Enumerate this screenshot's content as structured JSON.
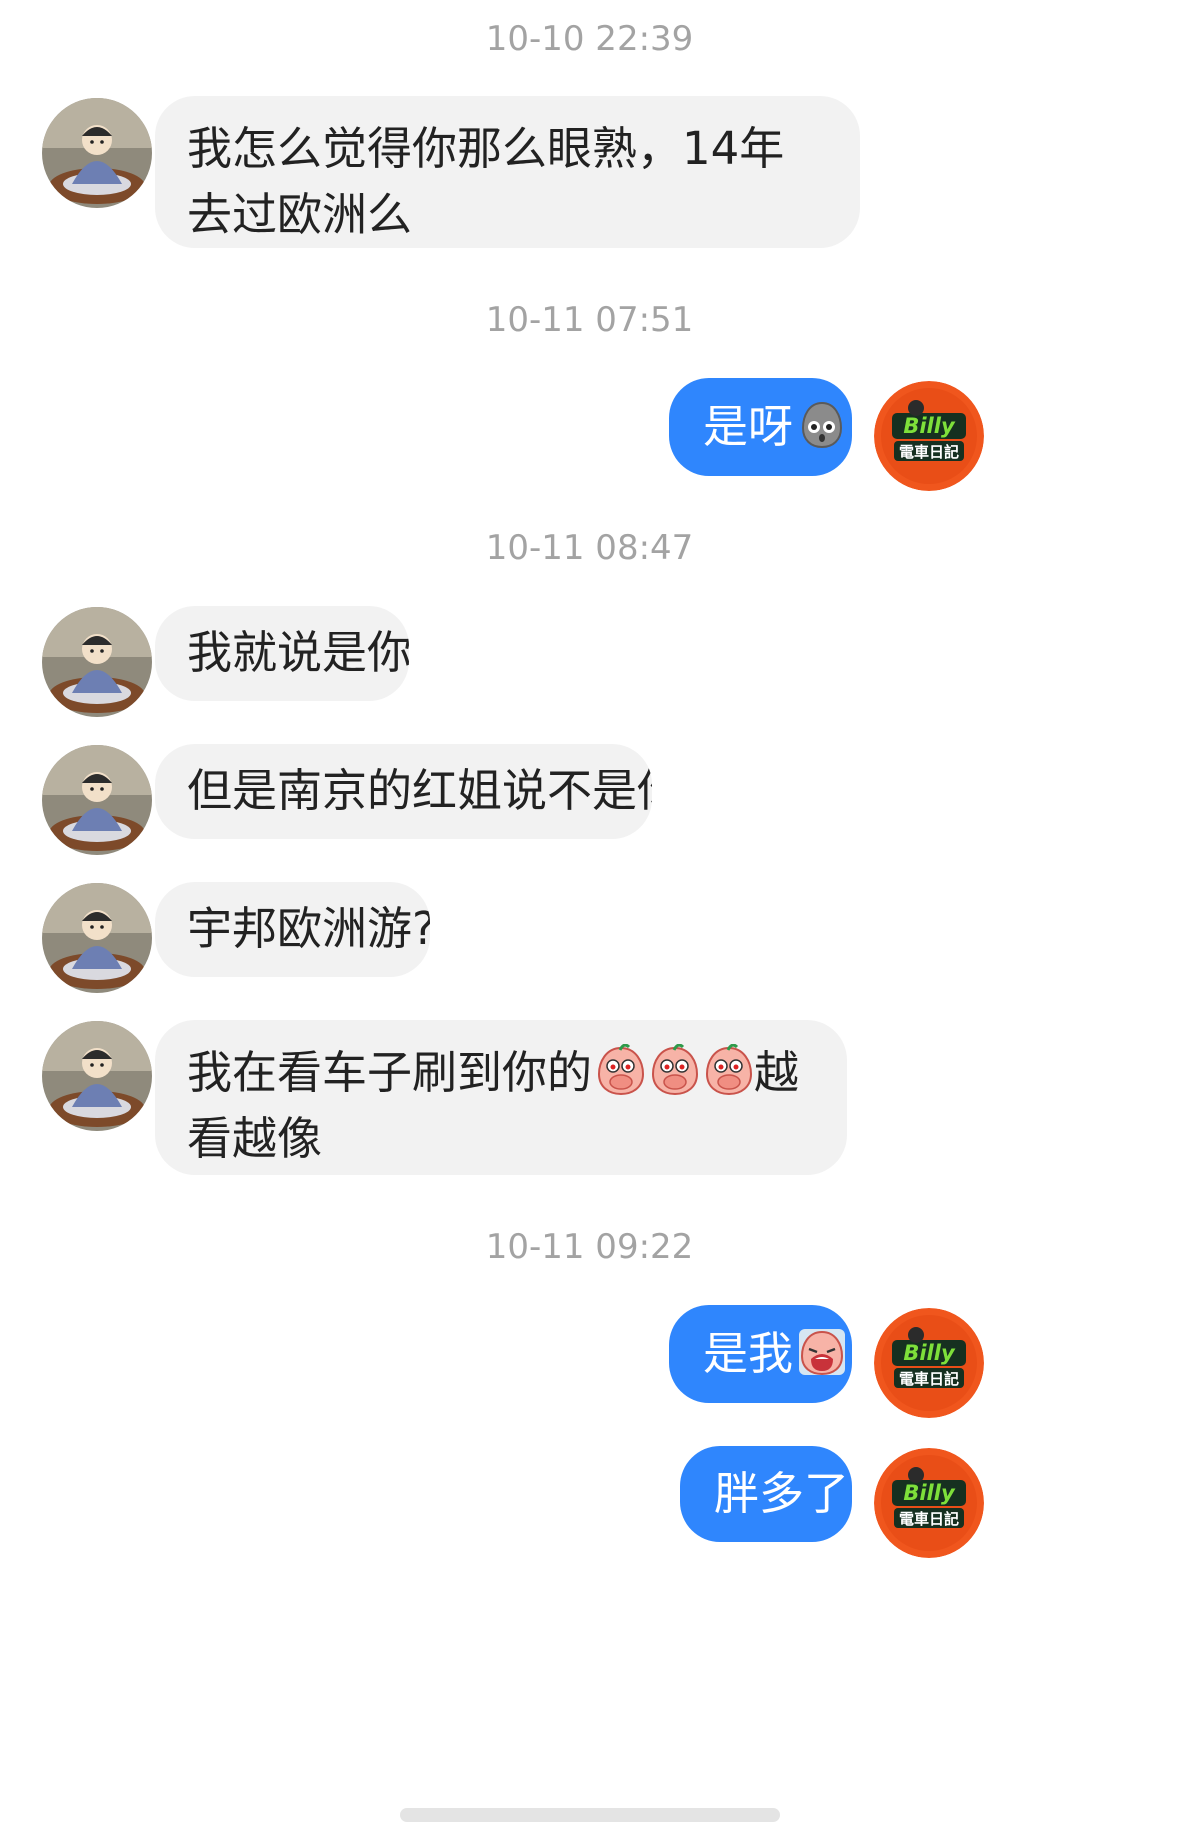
{
  "conversation": {
    "groups": [
      {
        "timestamp": "10-10 22:39",
        "messages": [
          {
            "direction": "in",
            "text": "我怎么觉得你那么眼熟，14年去过欧洲么"
          }
        ]
      },
      {
        "timestamp": "10-11 07:51",
        "messages": [
          {
            "direction": "out",
            "text": "是呀",
            "emoji": "gray-ghost-surprised-emoji"
          }
        ]
      },
      {
        "timestamp": "10-11 08:47",
        "messages": [
          {
            "direction": "in",
            "text": "我就说是你"
          },
          {
            "direction": "in",
            "text": "但是南京的红姐说不是你"
          },
          {
            "direction": "in",
            "text": "宇邦欧洲游?"
          },
          {
            "direction": "in",
            "text_before": "我在看车子刷到你的",
            "emojis": [
              "peach-cover-mouth-emoji",
              "peach-cover-mouth-emoji",
              "peach-cover-mouth-emoji"
            ],
            "text_after": "越看越像"
          }
        ]
      },
      {
        "timestamp": "10-11 09:22",
        "messages": [
          {
            "direction": "out",
            "text": "是我",
            "emoji": "peach-crying-emoji"
          },
          {
            "direction": "out",
            "text": "胖多了"
          }
        ]
      }
    ]
  },
  "avatars": {
    "contact": {
      "icon": "contact-avatar-photo"
    },
    "self": {
      "icon": "billy-logo-avatar",
      "logo_text_top": "Billy",
      "logo_text_bottom": "電車日記"
    }
  },
  "colors": {
    "incoming_bubble": "#f2f2f2",
    "outgoing_bubble": "#2f86fd",
    "timestamp": "#a3a3a3",
    "self_avatar_bg": "#f0561d"
  }
}
